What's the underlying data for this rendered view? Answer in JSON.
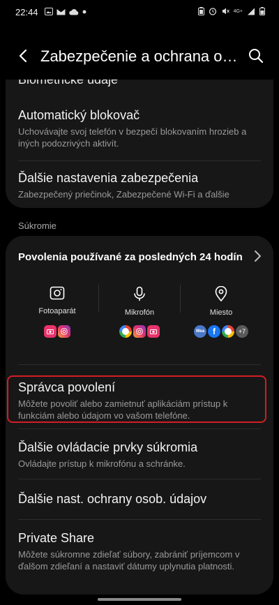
{
  "status_bar": {
    "time": "22:44",
    "network": "4G+"
  },
  "header": {
    "title": "Zabezpečenie a ochrana osob..."
  },
  "security": {
    "partial_item": "Biometrické údaje",
    "items": [
      {
        "title": "Automatický blokovač",
        "subtitle": "Uchovávajte svoj telefón v bezpečí blokovaním hrozieb a iných podozrivých aktivít."
      },
      {
        "title": "Ďalšie nastavenia zabezpečenia",
        "subtitle": "Zabezpečený priečinok, Zabezpečené Wi-Fi a ďalšie"
      }
    ]
  },
  "privacy": {
    "section_label": "Súkromie",
    "permissions_title": "Povolenia používané za posledných 24 hodín",
    "columns": [
      {
        "label": "Fotoaparát",
        "icon": "camera-icon"
      },
      {
        "label": "Mikrofón",
        "icon": "microphone-icon"
      },
      {
        "label": "Miesto",
        "icon": "location-icon"
      }
    ],
    "more_apps_count": "+7",
    "weather_app_label": "Wea",
    "items": [
      {
        "title": "Správca povolení",
        "subtitle": "Môžete povoliť alebo zamietnuť aplikáciám prístup k funkciám alebo údajom vo vašom telefóne."
      },
      {
        "title": "Ďalšie ovládacie prvky súkromia",
        "subtitle": "Ovládajte prístup k mikrofónu a schránke."
      },
      {
        "title": "Ďalšie nast. ochrany osob. údajov",
        "subtitle": ""
      },
      {
        "title": "Private Share",
        "subtitle": "Môžete súkromne zdieľať súbory, zabrániť príjemcom v ďalšom zdieľaní a nastaviť dátumy uplynutia platnosti."
      }
    ]
  },
  "colors": {
    "background": "#000000",
    "card": "#171717",
    "highlight_border": "#d41d25"
  }
}
